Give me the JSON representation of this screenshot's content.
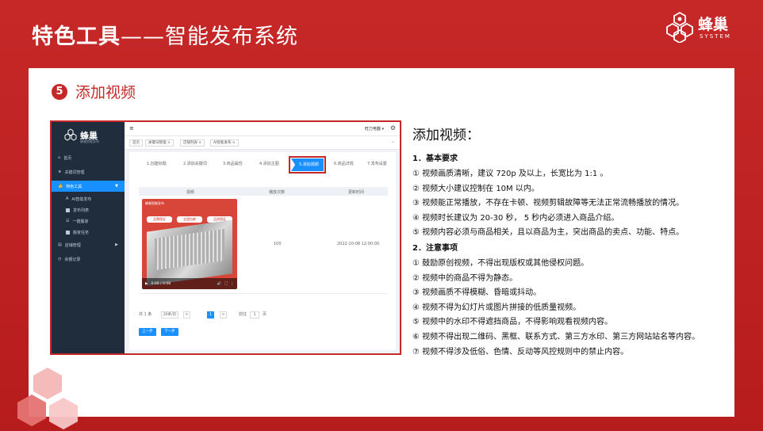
{
  "header": {
    "title_bold": "特色工具",
    "title_dash": "——",
    "title_light": "智能发布系统",
    "logo_cn": "蜂巢",
    "logo_en": "SYSTEM"
  },
  "section": {
    "number": "5",
    "title": "添加视频"
  },
  "screenshot": {
    "sidebar": {
      "logo_text": "蜂巢",
      "logo_sub": "蜂巢智能发布",
      "items": [
        {
          "label": "首页"
        },
        {
          "label": "关键词管理"
        },
        {
          "label": "特色工具"
        },
        {
          "label": "AI智能发布"
        },
        {
          "label": "发布列表"
        },
        {
          "label": "一键搬家"
        },
        {
          "label": "搬家任务"
        },
        {
          "label": "店铺管理"
        },
        {
          "label": "余额记录"
        }
      ]
    },
    "topbar": {
      "menu_icon": "≡",
      "user": "旺力电器 ▾",
      "gear": "⚙"
    },
    "tags": [
      {
        "label": "首页"
      },
      {
        "label": "关键词管理 ×"
      },
      {
        "label": "店铺列表 ×"
      },
      {
        "label": "AI智能发布 ×"
      }
    ],
    "tags_chevron": "⌄",
    "steps": [
      {
        "label": "1.创建标题"
      },
      {
        "label": "2.添加关键词"
      },
      {
        "label": "3.商品属性"
      },
      {
        "label": "4.添加主图"
      },
      {
        "label": "5.添加视频"
      },
      {
        "label": "6.商品详情"
      },
      {
        "label": "7.发布设置"
      }
    ],
    "table": {
      "headers": [
        "视频",
        "播放次数",
        "更新时间"
      ],
      "row": {
        "thumb_top": "蜂巢智能发布",
        "thumb_buttons": [
          "品牌保证",
          "全国包邮",
          "品质保证"
        ],
        "time_display": "0:00 / 0:08",
        "play_icon": "▶",
        "volume_icon": "🔊",
        "fullscreen_icon": "⛶",
        "more_icon": "⋮",
        "count": "100",
        "date": "2022-10-08 12:00:00"
      }
    },
    "pager": {
      "total": "共 1 条",
      "page_size": "20条/页",
      "prev": "<",
      "current": "1",
      "next": ">",
      "goto_label": "前往",
      "goto_value": "1",
      "page_unit": "页"
    },
    "buttons": {
      "prev_step": "上一步",
      "next_step": "下一步"
    }
  },
  "description": {
    "title": "添加视频：",
    "section1": "1．基本要求",
    "req": [
      "① 视频画质清晰，建议 720p 及以上，长宽比为 1:1 。",
      "② 视频大小建议控制在 10M 以内。",
      "③ 视频能正常播放，不存在卡顿、视频剪辑故障等无法正常流畅播放的情况。",
      "④ 视频时长建议为 20-30 秒， 5 秒内必须进入商品介绍。",
      "⑤ 视频内容必须与商品相关，且以商品为主，突出商品的卖点、功能、特点。"
    ],
    "section2": "2．注意事项",
    "notes": [
      "① 鼓励原创视频，不得出现版权或其他侵权问题。",
      "② 视频中的商品不得为静态。",
      "③ 视频画质不得模糊、昏暗或抖动。",
      "④ 视频不得为幻灯片或图片拼接的低质量视频。",
      "⑤ 视频中的水印不得遮挡商品，不得影响观看视频内容。",
      "⑥ 视频不得出现二维码、黑框、联系方式、第三方水印、第三方网站站名等内容。",
      "⑦ 视频不得涉及低俗、色情、反动等风控规则中的禁止内容。"
    ]
  },
  "colors": {
    "brand_red": "#c62828",
    "accent_blue": "#1890ff",
    "sidebar_dark": "#1f2d3d"
  }
}
